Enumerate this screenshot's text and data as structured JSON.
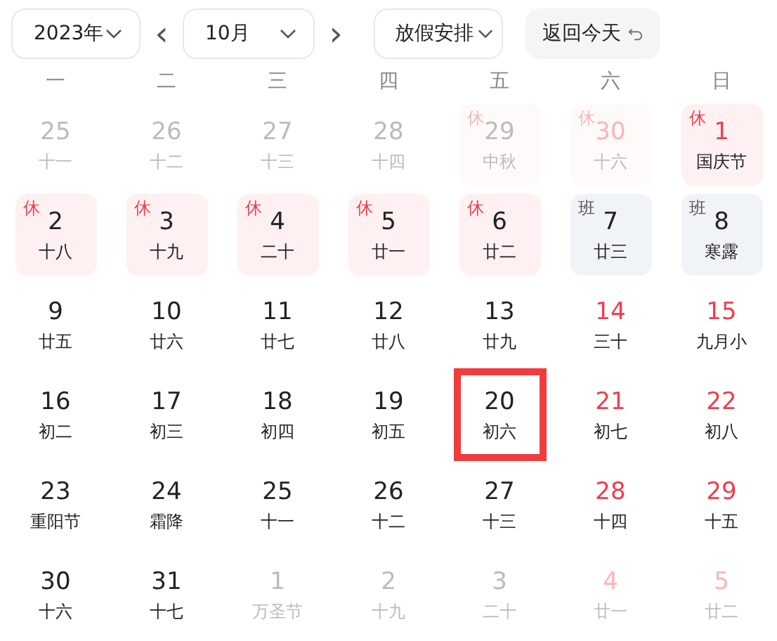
{
  "toolbar": {
    "year": "2023年",
    "prev": "‹",
    "month": "10月",
    "next": "›",
    "holiday": "放假安排",
    "today": "返回今天"
  },
  "weekdays": [
    "一",
    "二",
    "三",
    "四",
    "五",
    "六",
    "日"
  ],
  "weeks": [
    [
      {
        "day": "25",
        "lunar": "十一",
        "other_month": true,
        "weekend": false
      },
      {
        "day": "26",
        "lunar": "十二",
        "other_month": true,
        "weekend": false
      },
      {
        "day": "27",
        "lunar": "十三",
        "other_month": true,
        "weekend": false
      },
      {
        "day": "28",
        "lunar": "十四",
        "other_month": true,
        "weekend": false
      },
      {
        "day": "29",
        "lunar": "中秋",
        "other_month": true,
        "weekend": false,
        "badge": "休",
        "kind": "rest"
      },
      {
        "day": "30",
        "lunar": "十六",
        "other_month": true,
        "weekend": true,
        "badge": "休",
        "kind": "rest"
      },
      {
        "day": "1",
        "lunar": "国庆节",
        "other_month": false,
        "weekend": true,
        "badge": "休",
        "kind": "rest"
      }
    ],
    [
      {
        "day": "2",
        "lunar": "十八",
        "other_month": false,
        "weekend": false,
        "badge": "休",
        "kind": "rest"
      },
      {
        "day": "3",
        "lunar": "十九",
        "other_month": false,
        "weekend": false,
        "badge": "休",
        "kind": "rest"
      },
      {
        "day": "4",
        "lunar": "二十",
        "other_month": false,
        "weekend": false,
        "badge": "休",
        "kind": "rest"
      },
      {
        "day": "5",
        "lunar": "廿一",
        "other_month": false,
        "weekend": false,
        "badge": "休",
        "kind": "rest"
      },
      {
        "day": "6",
        "lunar": "廿二",
        "other_month": false,
        "weekend": false,
        "badge": "休",
        "kind": "rest"
      },
      {
        "day": "7",
        "lunar": "廿三",
        "other_month": false,
        "weekend": false,
        "badge": "班",
        "kind": "work"
      },
      {
        "day": "8",
        "lunar": "寒露",
        "other_month": false,
        "weekend": false,
        "badge": "班",
        "kind": "work"
      }
    ],
    [
      {
        "day": "9",
        "lunar": "廿五",
        "other_month": false,
        "weekend": false
      },
      {
        "day": "10",
        "lunar": "廿六",
        "other_month": false,
        "weekend": false
      },
      {
        "day": "11",
        "lunar": "廿七",
        "other_month": false,
        "weekend": false
      },
      {
        "day": "12",
        "lunar": "廿八",
        "other_month": false,
        "weekend": false
      },
      {
        "day": "13",
        "lunar": "廿九",
        "other_month": false,
        "weekend": false
      },
      {
        "day": "14",
        "lunar": "三十",
        "other_month": false,
        "weekend": true
      },
      {
        "day": "15",
        "lunar": "九月小",
        "other_month": false,
        "weekend": true
      }
    ],
    [
      {
        "day": "16",
        "lunar": "初二",
        "other_month": false,
        "weekend": false
      },
      {
        "day": "17",
        "lunar": "初三",
        "other_month": false,
        "weekend": false
      },
      {
        "day": "18",
        "lunar": "初四",
        "other_month": false,
        "weekend": false
      },
      {
        "day": "19",
        "lunar": "初五",
        "other_month": false,
        "weekend": false
      },
      {
        "day": "20",
        "lunar": "初六",
        "other_month": false,
        "weekend": false,
        "selected": true
      },
      {
        "day": "21",
        "lunar": "初七",
        "other_month": false,
        "weekend": true
      },
      {
        "day": "22",
        "lunar": "初八",
        "other_month": false,
        "weekend": true
      }
    ],
    [
      {
        "day": "23",
        "lunar": "重阳节",
        "other_month": false,
        "weekend": false
      },
      {
        "day": "24",
        "lunar": "霜降",
        "other_month": false,
        "weekend": false
      },
      {
        "day": "25",
        "lunar": "十一",
        "other_month": false,
        "weekend": false
      },
      {
        "day": "26",
        "lunar": "十二",
        "other_month": false,
        "weekend": false
      },
      {
        "day": "27",
        "lunar": "十三",
        "other_month": false,
        "weekend": false
      },
      {
        "day": "28",
        "lunar": "十四",
        "other_month": false,
        "weekend": true
      },
      {
        "day": "29",
        "lunar": "十五",
        "other_month": false,
        "weekend": true
      }
    ],
    [
      {
        "day": "30",
        "lunar": "十六",
        "other_month": false,
        "weekend": false
      },
      {
        "day": "31",
        "lunar": "十七",
        "other_month": false,
        "weekend": false
      },
      {
        "day": "1",
        "lunar": "万圣节",
        "other_month": true,
        "weekend": false
      },
      {
        "day": "2",
        "lunar": "十九",
        "other_month": true,
        "weekend": false
      },
      {
        "day": "3",
        "lunar": "二十",
        "other_month": true,
        "weekend": false
      },
      {
        "day": "4",
        "lunar": "廿一",
        "other_month": true,
        "weekend": true
      },
      {
        "day": "5",
        "lunar": "廿二",
        "other_month": true,
        "weekend": true
      }
    ]
  ]
}
